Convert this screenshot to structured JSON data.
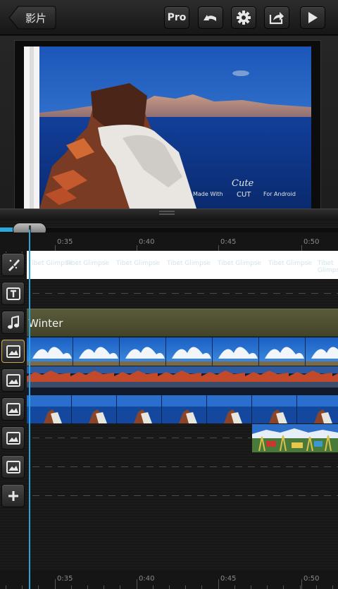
{
  "toolbar": {
    "back_label": "影片",
    "pro_label": "Pro",
    "undo_icon": "undo-icon",
    "settings_icon": "gear-icon",
    "share_icon": "share-icon",
    "play_icon": "play-icon"
  },
  "preview": {
    "watermark_line1": "Cute",
    "watermark_line2": "CUT",
    "watermark_made_with": "Made With",
    "watermark_for": "For Android"
  },
  "timeline": {
    "ruler_labels": [
      "0:35",
      "0:40",
      "0:45",
      "0:50"
    ],
    "title_track_text": "Tibet Glimpse",
    "audio_track_name": "Winter",
    "playhead_color": "#2aa3dc",
    "accent_color": "#2aa8e0"
  },
  "track_buttons": [
    {
      "icon": "brush-icon"
    },
    {
      "icon": "text-icon"
    },
    {
      "icon": "music-note-icon"
    },
    {
      "icon": "image-icon"
    },
    {
      "icon": "image-icon"
    },
    {
      "icon": "image-icon"
    },
    {
      "icon": "image-icon"
    },
    {
      "icon": "image-icon"
    },
    {
      "icon": "add-icon"
    }
  ]
}
